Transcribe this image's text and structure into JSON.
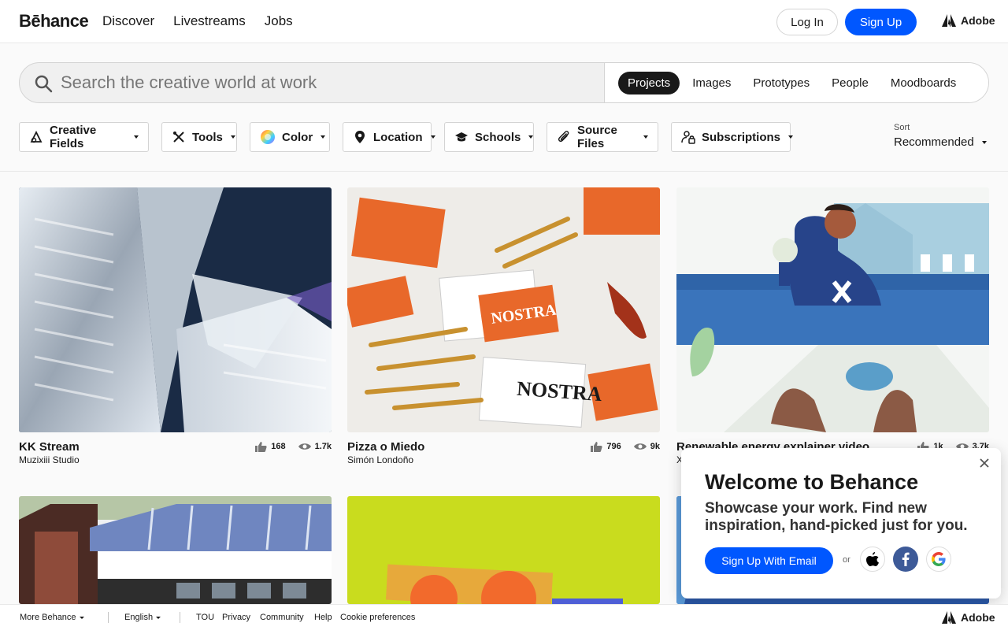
{
  "header": {
    "logo": "Bēhance",
    "nav": [
      "Discover",
      "Livestreams",
      "Jobs"
    ],
    "login_label": "Log In",
    "signup_label": "Sign Up",
    "adobe_label": "Adobe"
  },
  "search": {
    "placeholder": "Search the creative world at work",
    "tabs": [
      "Projects",
      "Images",
      "Prototypes",
      "People",
      "Moodboards"
    ],
    "active_tab": "Projects"
  },
  "filters": {
    "items": [
      {
        "label": "Creative Fields",
        "icon": "creative-fields-icon"
      },
      {
        "label": "Tools",
        "icon": "tools-icon"
      },
      {
        "label": "Color",
        "icon": "color-wheel-icon"
      },
      {
        "label": "Location",
        "icon": "location-pin-icon"
      },
      {
        "label": "Schools",
        "icon": "graduation-cap-icon"
      },
      {
        "label": "Source Files",
        "icon": "paperclip-icon"
      },
      {
        "label": "Subscriptions",
        "icon": "subscription-lock-icon"
      }
    ],
    "sort_label": "Sort",
    "sort_value": "Recommended"
  },
  "projects": [
    {
      "title": "KK Stream",
      "owner": "Muzixiii Studio",
      "likes": "168",
      "views": "1.7k"
    },
    {
      "title": "Pizza o Miedo",
      "owner": "Simón Londoño",
      "likes": "796",
      "views": "9k"
    },
    {
      "title": "Renewable energy explainer video",
      "owner": "X",
      "likes": "1k",
      "views": "3.7k"
    }
  ],
  "welcome": {
    "title": "Welcome to Behance",
    "text": "Showcase your work. Find new inspiration, hand-picked just for you.",
    "email_button": "Sign Up With Email",
    "or": "or"
  },
  "footer": {
    "more": "More Behance",
    "language": "English",
    "links": [
      "TOU",
      "Privacy",
      "Community",
      "Help",
      "Cookie preferences"
    ],
    "adobe_label": "Adobe"
  },
  "colors": {
    "accent": "#0057ff",
    "facebook": "#3d5a98"
  }
}
